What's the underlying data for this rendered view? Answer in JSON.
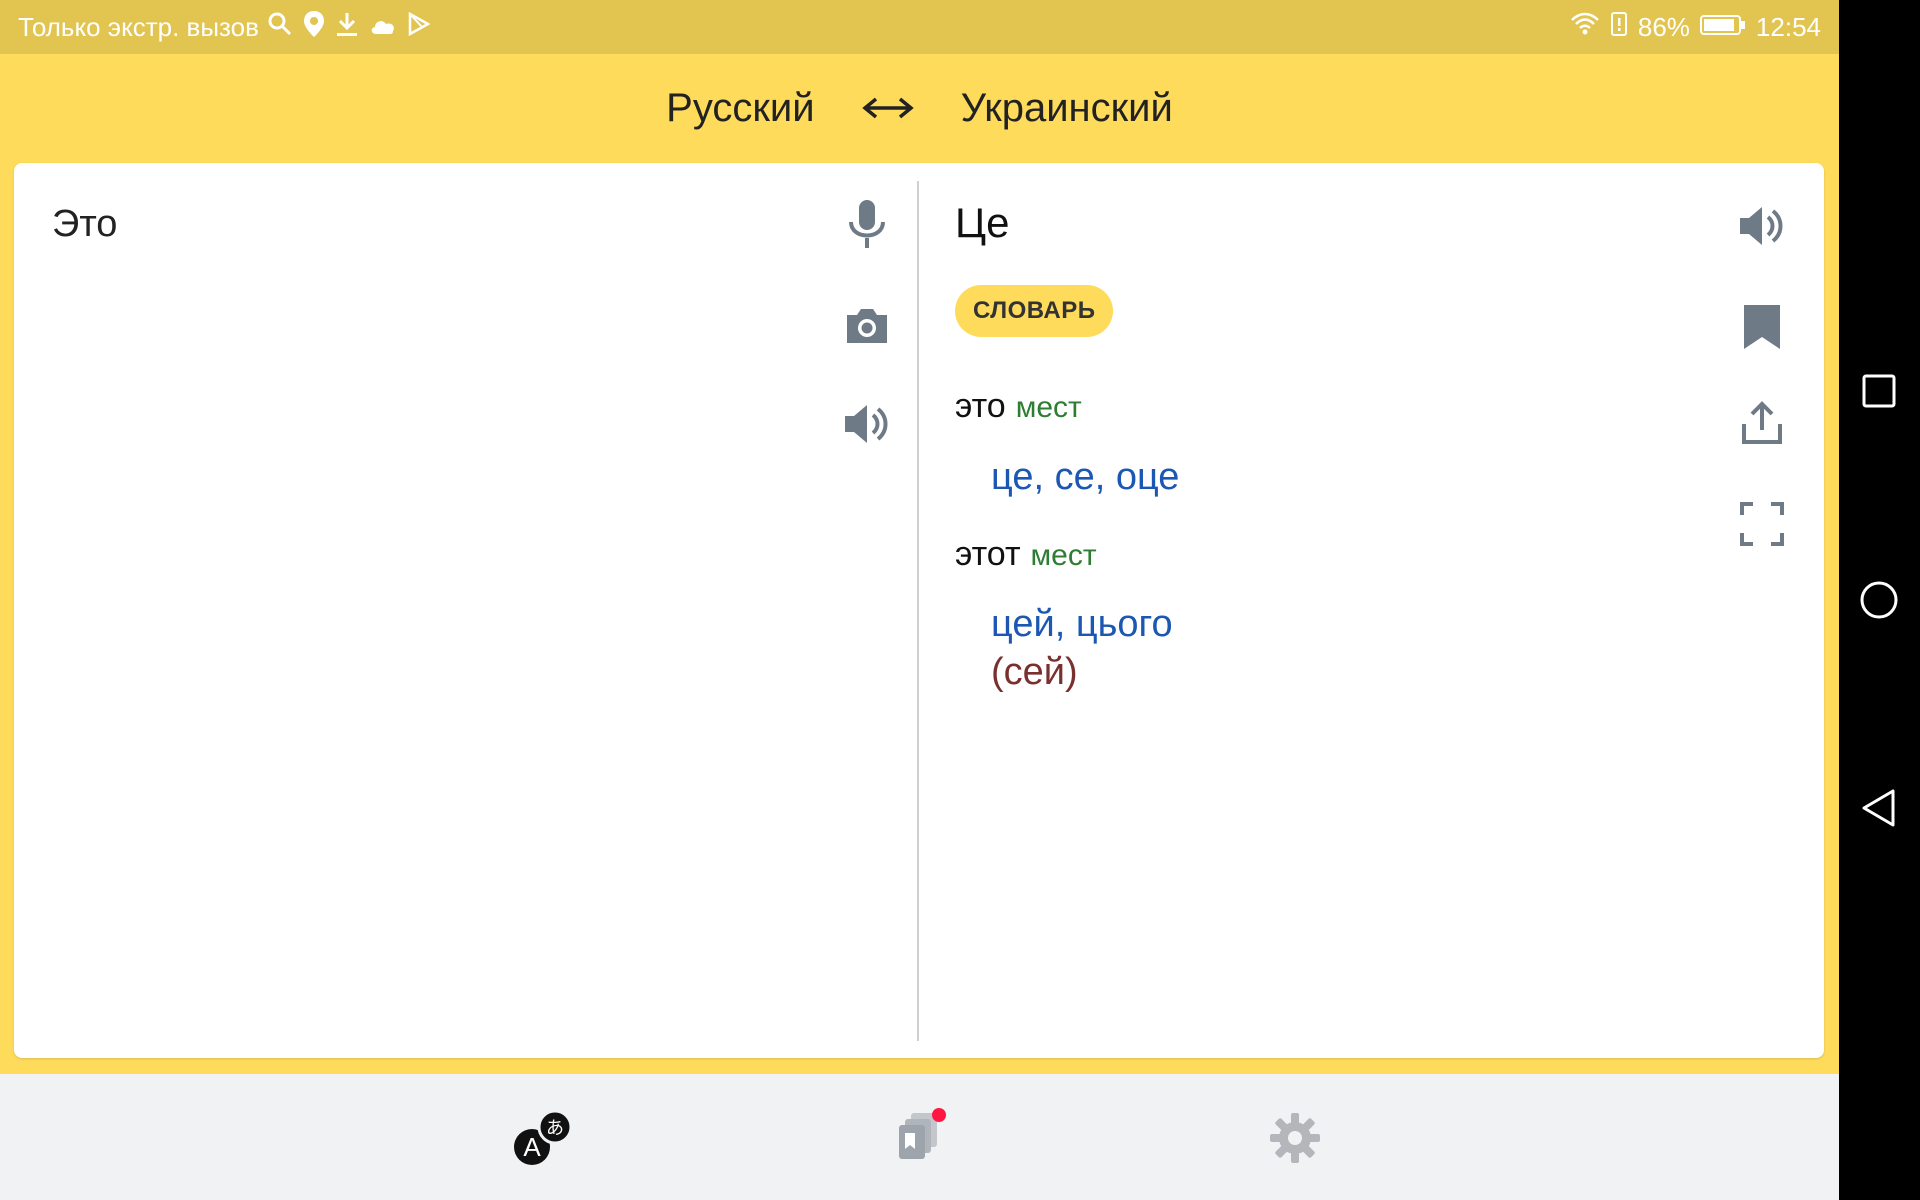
{
  "status_bar": {
    "carrier_text": "Только экстр. вызов",
    "battery": "86%",
    "time": "12:54",
    "icons": [
      "search-icon",
      "location-icon",
      "download-icon",
      "cloud-icon",
      "play-store-icon",
      "wifi-icon",
      "battery-alert-icon",
      "battery-icon"
    ]
  },
  "languages": {
    "source": "Русский",
    "target": "Украинский",
    "swap_icon": "swap-arrows-icon"
  },
  "source": {
    "text": "Это",
    "tools": [
      "microphone-icon",
      "camera-icon",
      "speaker-icon"
    ]
  },
  "result": {
    "translation": "Це",
    "dictionary_label": "СЛОВАРЬ",
    "entries": [
      {
        "word": "это",
        "pos": "мест",
        "translations": "це, се, оце"
      },
      {
        "word": "этот",
        "pos": "мест",
        "translations": "цей, цього",
        "note": "(сей)"
      }
    ],
    "tools": [
      "speaker-icon",
      "bookmark-icon",
      "share-icon",
      "fullscreen-icon"
    ]
  },
  "bottom_nav": {
    "items": [
      "translate-icon",
      "collections-icon",
      "settings-icon"
    ],
    "notification_color": "#ff1744"
  },
  "colors": {
    "accent": "#ffdb5c",
    "status_bar": "#e2c451",
    "translation_blue": "#1b57b3",
    "pos_green": "#2e7d32"
  }
}
